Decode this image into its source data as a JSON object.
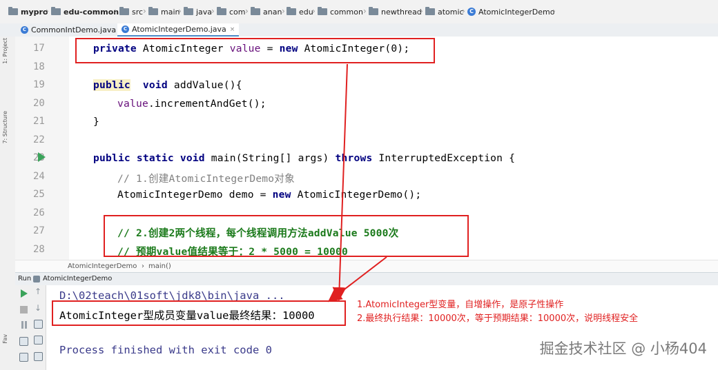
{
  "breadcrumb": [
    {
      "label": "mypro",
      "icon": "folder-icon",
      "bold": true
    },
    {
      "label": "edu-common",
      "icon": "folder-icon",
      "bold": true
    },
    {
      "label": "src",
      "icon": "folder-icon"
    },
    {
      "label": "main",
      "icon": "folder-icon"
    },
    {
      "label": "java",
      "icon": "folder-icon"
    },
    {
      "label": "com",
      "icon": "folder-icon"
    },
    {
      "label": "anan",
      "icon": "folder-icon"
    },
    {
      "label": "edu",
      "icon": "folder-icon"
    },
    {
      "label": "common",
      "icon": "folder-icon"
    },
    {
      "label": "newthread",
      "icon": "folder-icon"
    },
    {
      "label": "atomic",
      "icon": "folder-icon"
    },
    {
      "label": "AtomicIntegerDemo",
      "icon": "class-icon"
    }
  ],
  "tabs": [
    {
      "label": "CommonIntDemo.java",
      "close": "×",
      "active": false
    },
    {
      "label": "AtomicIntegerDemo.java",
      "close": "×",
      "active": true
    }
  ],
  "left_stripe": {
    "project_label": "1: Project",
    "structure_label": "7: Structure",
    "favorites_label": "Fav"
  },
  "gutter": {
    "line_numbers": [
      "17",
      "18",
      "19",
      "20",
      "21",
      "22",
      "23",
      "24",
      "25",
      "26",
      "27",
      "28"
    ]
  },
  "code": {
    "l17": {
      "kw1": "private",
      "t1": " AtomicInteger ",
      "field": "value",
      "t2": " = ",
      "kw2": "new",
      "t3": " AtomicInteger(0);"
    },
    "l19": {
      "kw1": "public",
      "t1": "  ",
      "kw2": "void",
      "t2": " addValue(){"
    },
    "l20": {
      "field": "value",
      "t1": ".incrementAndGet();"
    },
    "l21": {
      "t1": "}"
    },
    "l23": {
      "kw1": "public",
      "t1": " ",
      "kw2": "static",
      "t2": " ",
      "kw3": "void",
      "t3": " main(String[] args) ",
      "kw4": "throws",
      "t4": " InterruptedException {"
    },
    "l24": {
      "comment": "// 1.创建AtomicIntegerDemo对象"
    },
    "l25": {
      "t1": "AtomicIntegerDemo demo = ",
      "kw1": "new",
      "t2": " AtomicIntegerDemo();"
    },
    "l27": {
      "comment": "// 2.创建2两个线程，每个线程调用方法addValue 5000次"
    },
    "l28": {
      "comment": "// 预期value值结果等于：2 * 5000 = 10000"
    }
  },
  "editor_breadcrumb": {
    "class_name": "AtomicIntegerDemo",
    "sep": "›",
    "method": "main()"
  },
  "run_panel": {
    "run_label": "Run",
    "config_name": "AtomicIntegerDemo"
  },
  "console": {
    "command": "D:\\02teach\\01soft\\jdk8\\bin\\java ...",
    "result": "AtomicInteger型成员变量value最终结果：10000",
    "exit": "Process finished with exit code 0"
  },
  "annotations": {
    "note1": "1.AtomicInteger型变量，自增操作，是原子性操作",
    "note2": "2.最终执行结果：10000次，等于预期结果：10000次，说明线程安全"
  },
  "watermark": "掘金技术社区 @ 小杨404",
  "colors": {
    "annotation_red": "#e02020",
    "keyword": "#000080",
    "field": "#660e7a",
    "comment": "#808080",
    "run_green": "#3aa35a"
  }
}
